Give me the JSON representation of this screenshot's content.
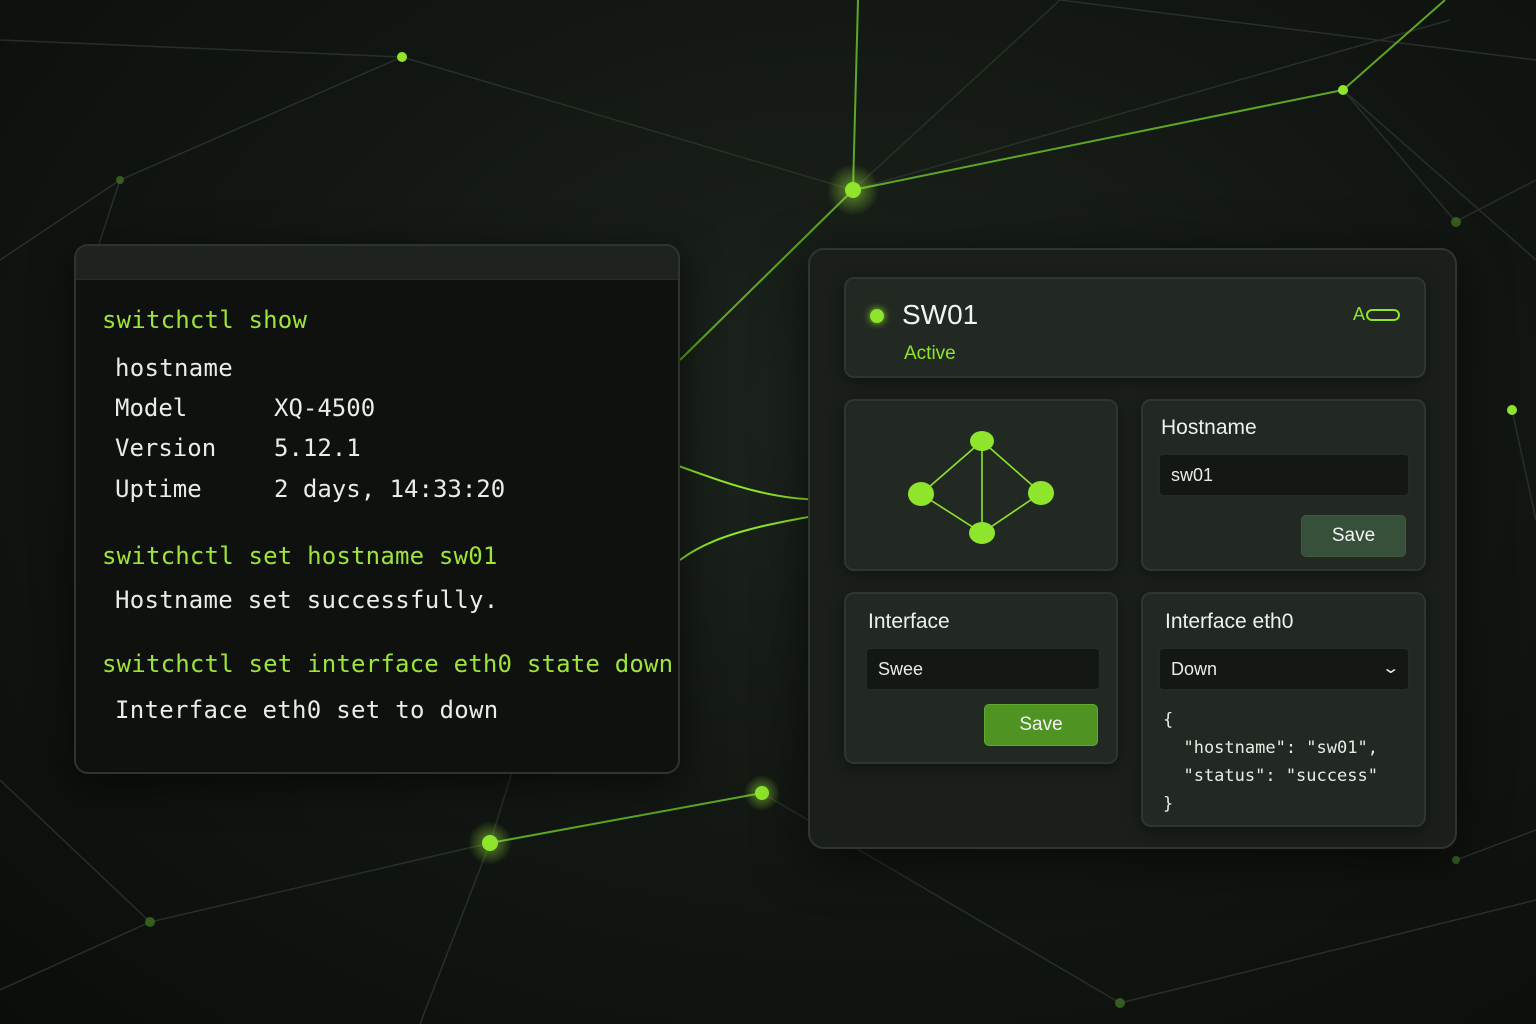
{
  "terminal": {
    "commands": [
      "switchctl show",
      "switchctl set hostname sw01",
      "switchctl set interface eth0 state down"
    ],
    "show_output": {
      "hostname_label": "hostname",
      "rows": [
        {
          "key": "Model",
          "value": "XQ-4500"
        },
        {
          "key": "Version",
          "value": "5.12.1"
        },
        {
          "key": "Uptime",
          "value": "2 days, 14:33:20"
        }
      ]
    },
    "hostname_output": "Hostname set successfully.",
    "interface_output": "Interface eth0 set to down"
  },
  "dashboard": {
    "status": {
      "name": "SW01",
      "state": "Active",
      "toggle_label": "A"
    },
    "hostname_card": {
      "label": "Hostname",
      "value": "sw01",
      "save_label": "Save"
    },
    "interface_card": {
      "label": "Interface",
      "value": "Swee",
      "save_label": "Save"
    },
    "eth_card": {
      "label": "Interface eth0",
      "selected": "Down",
      "json_lines": [
        "{",
        "  \"hostname\": \"sw01\",",
        "  \"status\": \"success\"",
        "}"
      ]
    }
  },
  "colors": {
    "accent": "#8ee52c",
    "background": "#121612",
    "panel": "#1a1f1a",
    "card": "#222822"
  },
  "icons": {
    "status": "status-dot-icon",
    "toggle": "toggle-switch-icon",
    "select": "chevron-down-icon",
    "topology": "network-topology-icon"
  }
}
